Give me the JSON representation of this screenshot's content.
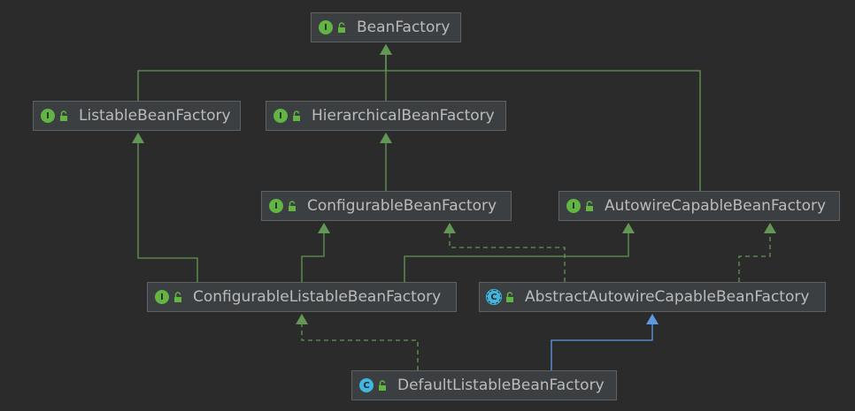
{
  "diagram": {
    "nodes": [
      {
        "id": "BeanFactory",
        "label": "BeanFactory",
        "kind": "interface",
        "badge": "I"
      },
      {
        "id": "ListableBeanFactory",
        "label": "ListableBeanFactory",
        "kind": "interface",
        "badge": "I"
      },
      {
        "id": "HierarchicalBeanFactory",
        "label": "HierarchicalBeanFactory",
        "kind": "interface",
        "badge": "I"
      },
      {
        "id": "ConfigurableBeanFactory",
        "label": "ConfigurableBeanFactory",
        "kind": "interface",
        "badge": "I"
      },
      {
        "id": "AutowireCapableBeanFactory",
        "label": "AutowireCapableBeanFactory",
        "kind": "interface",
        "badge": "I"
      },
      {
        "id": "ConfigurableListableBeanFactory",
        "label": "ConfigurableListableBeanFactory",
        "kind": "interface",
        "badge": "I"
      },
      {
        "id": "AbstractAutowireCapableBeanFactory",
        "label": "AbstractAutowireCapableBeanFactory",
        "kind": "abstract-class",
        "badge": "C"
      },
      {
        "id": "DefaultListableBeanFactory",
        "label": "DefaultListableBeanFactory",
        "kind": "class",
        "badge": "C"
      }
    ],
    "edges": [
      {
        "from": "ListableBeanFactory",
        "to": "BeanFactory",
        "type": "extends"
      },
      {
        "from": "HierarchicalBeanFactory",
        "to": "BeanFactory",
        "type": "extends"
      },
      {
        "from": "AutowireCapableBeanFactory",
        "to": "BeanFactory",
        "type": "extends"
      },
      {
        "from": "ConfigurableBeanFactory",
        "to": "HierarchicalBeanFactory",
        "type": "extends"
      },
      {
        "from": "ConfigurableListableBeanFactory",
        "to": "ListableBeanFactory",
        "type": "extends"
      },
      {
        "from": "ConfigurableListableBeanFactory",
        "to": "ConfigurableBeanFactory",
        "type": "extends"
      },
      {
        "from": "ConfigurableListableBeanFactory",
        "to": "AutowireCapableBeanFactory",
        "type": "extends"
      },
      {
        "from": "AbstractAutowireCapableBeanFactory",
        "to": "ConfigurableBeanFactory",
        "type": "implements"
      },
      {
        "from": "AbstractAutowireCapableBeanFactory",
        "to": "AutowireCapableBeanFactory",
        "type": "implements"
      },
      {
        "from": "DefaultListableBeanFactory",
        "to": "ConfigurableListableBeanFactory",
        "type": "implements"
      },
      {
        "from": "DefaultListableBeanFactory",
        "to": "AbstractAutowireCapableBeanFactory",
        "type": "class-extends"
      }
    ],
    "colors": {
      "background": "#2b2b2b",
      "node_fill": "#3c3f41",
      "node_border": "#5e6264",
      "text": "#bbbbbb",
      "interface_edge": "#629755",
      "class_edge": "#5d9ae6",
      "interface_badge": "#62b543",
      "class_badge": "#40b6e0"
    },
    "icons": {
      "interface": "interface-icon",
      "class": "class-icon",
      "abstract": "abstract-class-icon",
      "visibility": "public-lock-icon"
    }
  }
}
